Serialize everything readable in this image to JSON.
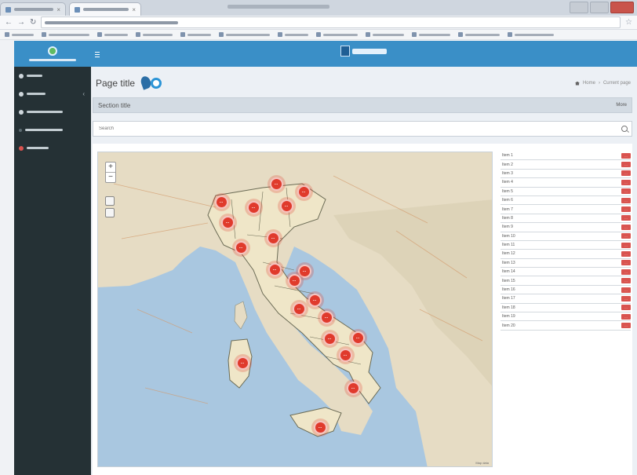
{
  "browser": {
    "tabs": [
      {
        "label": "Tab 1"
      },
      {
        "label": "Tab 2"
      }
    ],
    "address_bar_url": "URL"
  },
  "sidebar": {
    "items": [
      {
        "label": "Nav item 1",
        "icon": "globe-icon"
      },
      {
        "label": "Nav item 2",
        "icon": "home-icon",
        "has_submenu": true
      },
      {
        "label": "Nav item 3",
        "icon": "map-icon"
      },
      {
        "label": "Nav item 4",
        "icon": "submenu-dot-icon"
      },
      {
        "label": "Nav item 5",
        "icon": "alert-icon"
      }
    ]
  },
  "header": {
    "menu_icon": "hamburger-icon",
    "app_name": "App name"
  },
  "page": {
    "title": "Page title",
    "breadcrumb": [
      "Home",
      "Current page"
    ]
  },
  "section": {
    "title": "Section title",
    "more_link": "More"
  },
  "search": {
    "placeholder": "Search"
  },
  "map": {
    "zoom_in": "+",
    "zoom_out": "−",
    "attribution": "Map data",
    "bubbles": [
      {
        "count": "…"
      },
      {
        "count": "…"
      },
      {
        "count": "…"
      },
      {
        "count": "…"
      },
      {
        "count": "…"
      },
      {
        "count": "…"
      },
      {
        "count": "…"
      },
      {
        "count": "…"
      },
      {
        "count": "…"
      },
      {
        "count": "…"
      },
      {
        "count": "…"
      },
      {
        "count": "…"
      },
      {
        "count": "…"
      },
      {
        "count": "…"
      },
      {
        "count": "…"
      },
      {
        "count": "…"
      },
      {
        "count": "…"
      },
      {
        "count": "…"
      },
      {
        "count": "…"
      },
      {
        "count": "…"
      }
    ]
  },
  "regions": [
    {
      "name": "Item 1",
      "count": "…"
    },
    {
      "name": "Item 2",
      "count": "…"
    },
    {
      "name": "Item 3",
      "count": "…"
    },
    {
      "name": "Item 4",
      "count": "…"
    },
    {
      "name": "Item 5",
      "count": "…"
    },
    {
      "name": "Item 6",
      "count": "…"
    },
    {
      "name": "Item 7",
      "count": "…"
    },
    {
      "name": "Item 8",
      "count": "…"
    },
    {
      "name": "Item 9",
      "count": "…"
    },
    {
      "name": "Item 10",
      "count": "…"
    },
    {
      "name": "Item 11",
      "count": "…"
    },
    {
      "name": "Item 12",
      "count": "…"
    },
    {
      "name": "Item 13",
      "count": "…"
    },
    {
      "name": "Item 14",
      "count": "…"
    },
    {
      "name": "Item 15",
      "count": "…"
    },
    {
      "name": "Item 16",
      "count": "…"
    },
    {
      "name": "Item 17",
      "count": "…"
    },
    {
      "name": "Item 18",
      "count": "…"
    },
    {
      "name": "Item 19",
      "count": "…"
    },
    {
      "name": "Item 20",
      "count": "…"
    }
  ],
  "colors": {
    "header": "#3a8fc7",
    "sidebar": "#253135",
    "bubble": "#e03a2c",
    "badge": "#d9534f"
  }
}
